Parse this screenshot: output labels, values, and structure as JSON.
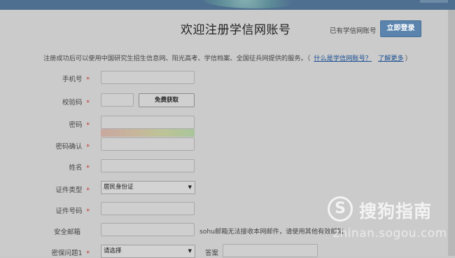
{
  "header": {
    "title": "欢迎注册学信网账号",
    "have_account": "已有学信网账号",
    "login_button": "立即登录"
  },
  "notice": {
    "text": "注册成功后可以使用中国研究生招生信息网、阳光高考、学信档案、全国征兵网提供的服务。（",
    "link_what": "什么是学信网账号？",
    "link_more": "了解更多",
    "end": "）"
  },
  "form": {
    "phone_label": "手机号",
    "code_label": "校验码",
    "code_button": "免费获取",
    "password_label": "密码",
    "password_confirm_label": "密码确认",
    "name_label": "姓名",
    "id_type_label": "证件类型",
    "id_type_value": "居民身份证",
    "id_number_label": "证件号码",
    "email_label": "安全邮箱",
    "email_hint": "sohu邮箱无法接收本网邮件，请使用其他有效邮箱",
    "question_label": "密保问题1",
    "question_value": "请选择",
    "answer_label": "答案",
    "required_mark": "*"
  },
  "watermark": {
    "logo_glyph": "S",
    "name": "搜狗指南",
    "url": "zhinan.sogou.com"
  },
  "colors": {
    "topbar": "#4e6f90",
    "login_button": "#5a84ad",
    "link": "#1b4f93",
    "required": "#c0302f"
  }
}
